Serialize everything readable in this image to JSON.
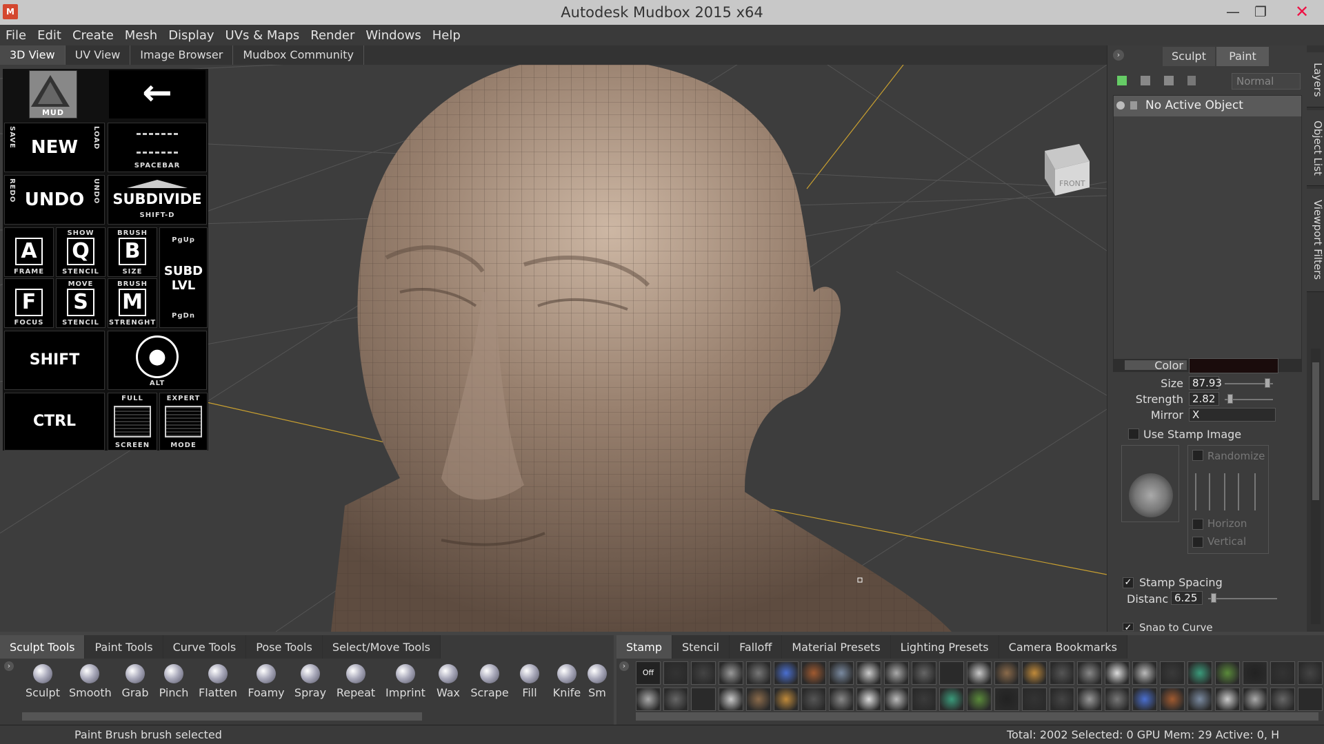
{
  "window": {
    "title": "Autodesk Mudbox 2015 x64",
    "logo": "mudbox-logo",
    "min": "—",
    "max": "❐",
    "close": "✕"
  },
  "menu": [
    "File",
    "Edit",
    "Create",
    "Mesh",
    "Display",
    "UVs & Maps",
    "Render",
    "Windows",
    "Help"
  ],
  "view_tabs": [
    "3D View",
    "UV View",
    "Image Browser",
    "Mudbox Community"
  ],
  "viewport": {
    "view_cube_label": "FRONT"
  },
  "cheatsheet": {
    "logo_label": "MUD",
    "arrow": "←",
    "new": "NEW",
    "save": "SAVE",
    "load": "LOAD",
    "spacebar": "SPACEBAR",
    "undo": "UNDO",
    "redo": "REDO",
    "undo_side": "UNDO",
    "subdivide": "SUBDIVIDE",
    "subdivide_key": "SHIFT-D",
    "a": "A",
    "a_label": "FRAME",
    "q": "Q",
    "q_top": "SHOW",
    "q_label": "STENCIL",
    "b": "B",
    "b_top": "BRUSH",
    "b_label": "SIZE",
    "pgup": "PgUp",
    "subd": "SUBD",
    "lvl": "LVL",
    "pgdn": "PgDn",
    "f": "F",
    "f_label": "FOCUS",
    "s": "S",
    "s_top": "MOVE",
    "s_label": "STENCIL",
    "m": "M",
    "m_top": "BRUSH",
    "m_label": "STRENGHT",
    "shift": "SHIFT",
    "alt": "ALT",
    "ctrl": "CTRL",
    "full_top": "FULL",
    "full_label": "SCREEN",
    "expert_top": "EXPERT",
    "expert_label": "MODE"
  },
  "right_panel": {
    "tabs": [
      "Sculpt",
      "Paint"
    ],
    "blend_mode": "Normal",
    "layer": "No Active Object",
    "color_label": "Color",
    "color_value": "#1a0c0c",
    "size_label": "Size",
    "size_value": "87.93",
    "strength_label": "Strength",
    "strength_value": "2.82",
    "mirror_label": "Mirror",
    "mirror_value": "X",
    "use_stamp_label": "Use Stamp Image",
    "randomize_label": "Randomize",
    "horizon_label": "Horizon",
    "vertical_label": "Vertical",
    "stamp_spacing_label": "Stamp Spacing",
    "distance_label": "Distanc",
    "distance_value": "6.25",
    "snap_label": "Snap to Curve"
  },
  "side_tabs": [
    "Layers",
    "Object List",
    "Viewport Filters"
  ],
  "tray_left": {
    "tabs": [
      "Sculpt Tools",
      "Paint Tools",
      "Curve Tools",
      "Pose Tools",
      "Select/Move Tools"
    ],
    "tools": [
      "Sculpt",
      "Smooth",
      "Grab",
      "Pinch",
      "Flatten",
      "Foamy",
      "Spray",
      "Repeat",
      "Imprint",
      "Wax",
      "Scrape",
      "Fill",
      "Knife",
      "Sm"
    ]
  },
  "tray_right": {
    "tabs": [
      "Stamp",
      "Stencil",
      "Falloff",
      "Material Presets",
      "Lighting Presets",
      "Camera Bookmarks"
    ],
    "off_label": "Off"
  },
  "status": {
    "message": "Paint Brush brush selected",
    "stats": "Total: 2002  Selected: 0 GPU Mem: 29  Active: 0, H"
  },
  "colors": {
    "skin": "#8e7462",
    "grid_line": "#4f4f4f",
    "axis_line": "#c9a030",
    "accent_red": "#d4472f"
  }
}
